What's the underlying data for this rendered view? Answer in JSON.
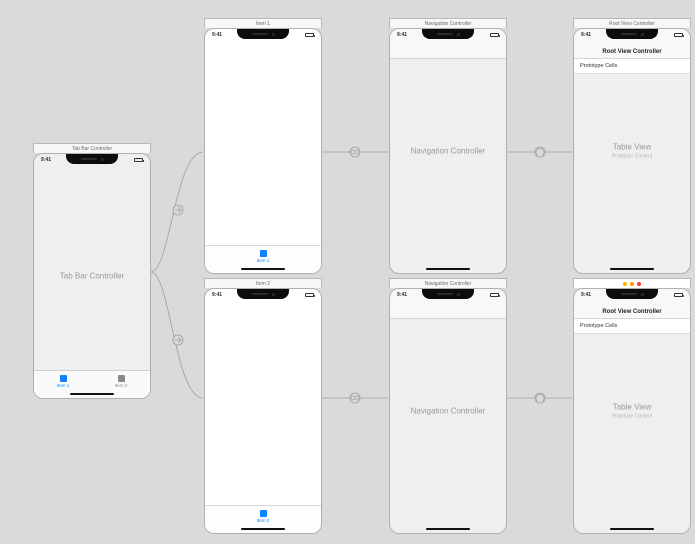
{
  "scenes": {
    "tabbar": {
      "title": "Tab Bar Controller",
      "time": "9:41",
      "center": "Tab Bar Controller",
      "tabs": [
        {
          "label": "Item 1",
          "active": true
        },
        {
          "label": "Item 2",
          "active": false
        }
      ]
    },
    "item1": {
      "title": "Item 1",
      "time": "9:41",
      "tab_label": "Item 1"
    },
    "item2": {
      "title": "Item 2",
      "time": "9:41",
      "tab_label": "Item 2"
    },
    "nav1": {
      "title": "Navigation Controller",
      "time": "9:41",
      "center": "Navigation Controller"
    },
    "nav2": {
      "title": "Navigation Controller",
      "time": "9:41",
      "center": "Navigation Controller"
    },
    "root1": {
      "title": "Root View Controller",
      "time": "9:41",
      "nav_title": "Root View Controller",
      "proto_label": "Prototype Cells",
      "center": "Table View",
      "center_sub": "Prototype Content"
    },
    "root2": {
      "title": "Root View Controller",
      "time": "9:41",
      "nav_title": "Root View Controller",
      "proto_label": "Prototype Cells",
      "center": "Table View",
      "center_sub": "Prototype Content",
      "selected": true
    }
  }
}
